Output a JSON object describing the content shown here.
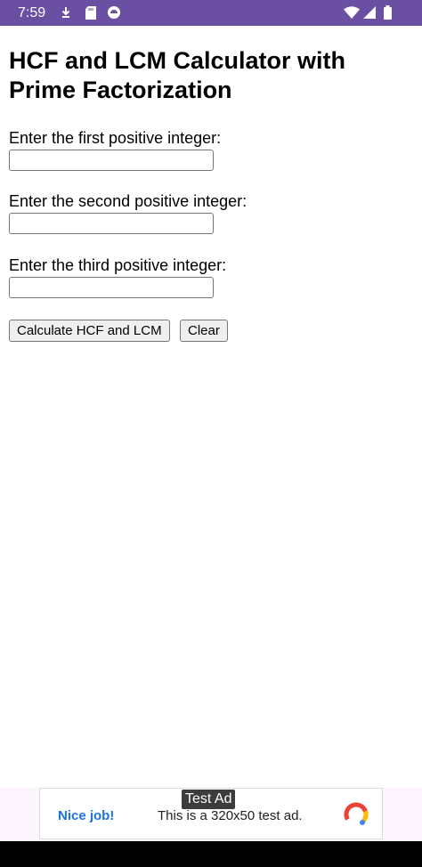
{
  "status_bar": {
    "time": "7:59",
    "icons": [
      "download-icon",
      "sd-card-icon",
      "app-notification-icon",
      "wifi-icon",
      "signal-icon",
      "battery-icon"
    ],
    "background": "#6b4fa3"
  },
  "page": {
    "title": "HCF and LCM Calculator with Prime Factorization",
    "inputs": [
      {
        "label": "Enter the first positive integer:",
        "value": ""
      },
      {
        "label": "Enter the second positive integer:",
        "value": ""
      },
      {
        "label": "Enter the third positive integer:",
        "value": ""
      }
    ],
    "buttons": {
      "calculate": "Calculate HCF and LCM",
      "clear": "Clear"
    }
  },
  "ad": {
    "badge": "Test Ad",
    "headline": "Nice job!",
    "body": "This is a 320x50 test ad.",
    "accent": "#1a73e8"
  }
}
